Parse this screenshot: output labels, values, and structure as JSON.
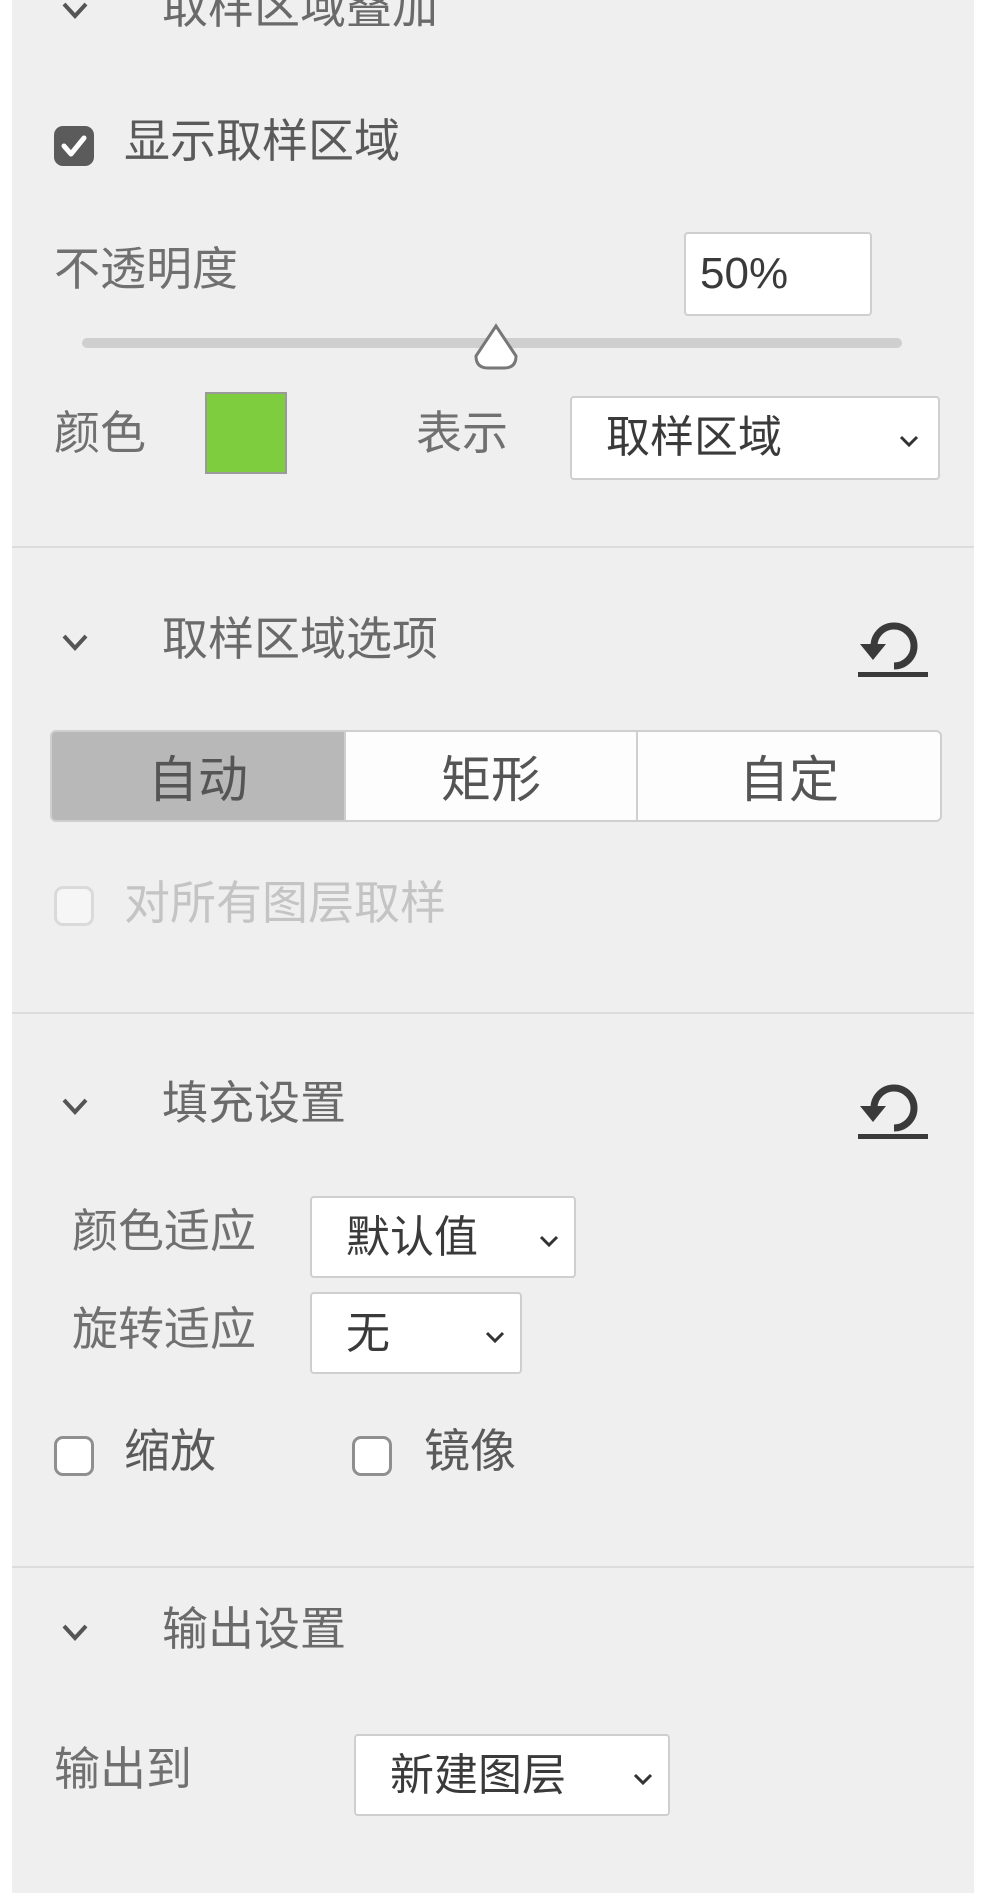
{
  "overlay": {
    "title": "取样区域叠加",
    "show_area_label": "显示取样区域",
    "show_area_checked": true,
    "opacity_label": "不透明度",
    "opacity_value": "50%",
    "opacity_level": 0.5,
    "color_label": "颜色",
    "swatch_color": "#7dcd3f",
    "display_label": "表示",
    "display_value": "取样区域"
  },
  "sampling": {
    "title": "取样区域选项",
    "modes": [
      "自动",
      "矩形",
      "自定"
    ],
    "selected_mode": "自动",
    "all_layers_label": "对所有图层取样",
    "all_layers_checked": false
  },
  "fill": {
    "title": "填充设置",
    "color_adapt_label": "颜色适应",
    "color_adapt_value": "默认值",
    "rotation_adapt_label": "旋转适应",
    "rotation_adapt_value": "无",
    "scale_label": "缩放",
    "scale_checked": false,
    "mirror_label": "镜像",
    "mirror_checked": false
  },
  "output": {
    "title": "输出设置",
    "output_to_label": "输出到",
    "output_to_value": "新建图层"
  },
  "icons": {
    "chevron": "chevron-down-icon",
    "reset": "reset-icon",
    "check": "check-icon"
  },
  "colors": {
    "panel_bg": "#efefef",
    "selected_segment": "#b8b8b8"
  }
}
